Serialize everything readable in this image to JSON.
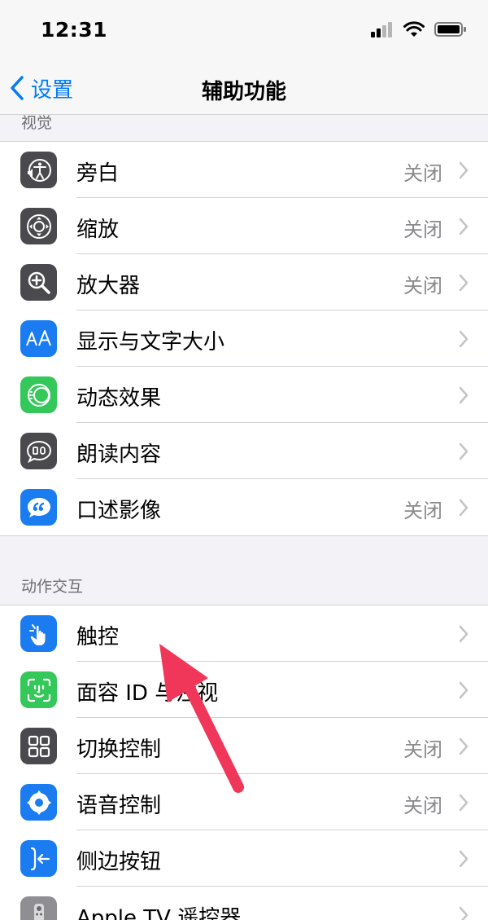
{
  "status_bar": {
    "time": "12:31"
  },
  "nav": {
    "back_label": "设置",
    "title": "辅助功能"
  },
  "sections": {
    "vision": {
      "header": "视觉",
      "items": [
        {
          "label": "旁白",
          "value": "关闭",
          "icon": "voiceover-icon"
        },
        {
          "label": "缩放",
          "value": "关闭",
          "icon": "zoom-icon"
        },
        {
          "label": "放大器",
          "value": "关闭",
          "icon": "magnifier-icon"
        },
        {
          "label": "显示与文字大小",
          "value": "",
          "icon": "text-size-icon"
        },
        {
          "label": "动态效果",
          "value": "",
          "icon": "motion-icon"
        },
        {
          "label": "朗读内容",
          "value": "",
          "icon": "spoken-content-icon"
        },
        {
          "label": "口述影像",
          "value": "关闭",
          "icon": "audio-description-icon"
        }
      ]
    },
    "interaction": {
      "header": "动作交互",
      "items": [
        {
          "label": "触控",
          "value": "",
          "icon": "touch-icon"
        },
        {
          "label": "面容 ID 与注视",
          "value": "",
          "icon": "face-id-icon"
        },
        {
          "label": "切换控制",
          "value": "关闭",
          "icon": "switch-control-icon"
        },
        {
          "label": "语音控制",
          "value": "关闭",
          "icon": "voice-control-icon"
        },
        {
          "label": "侧边按钮",
          "value": "",
          "icon": "side-button-icon"
        },
        {
          "label": "Apple TV 遥控器",
          "value": "",
          "icon": "apple-tv-remote-icon"
        }
      ]
    }
  },
  "colors": {
    "accent": "#007aff",
    "annotation_arrow": "#f0375a",
    "icon_dark": "#4a4a4e",
    "icon_blue": "#1a7cf0",
    "icon_green": "#34c759"
  }
}
